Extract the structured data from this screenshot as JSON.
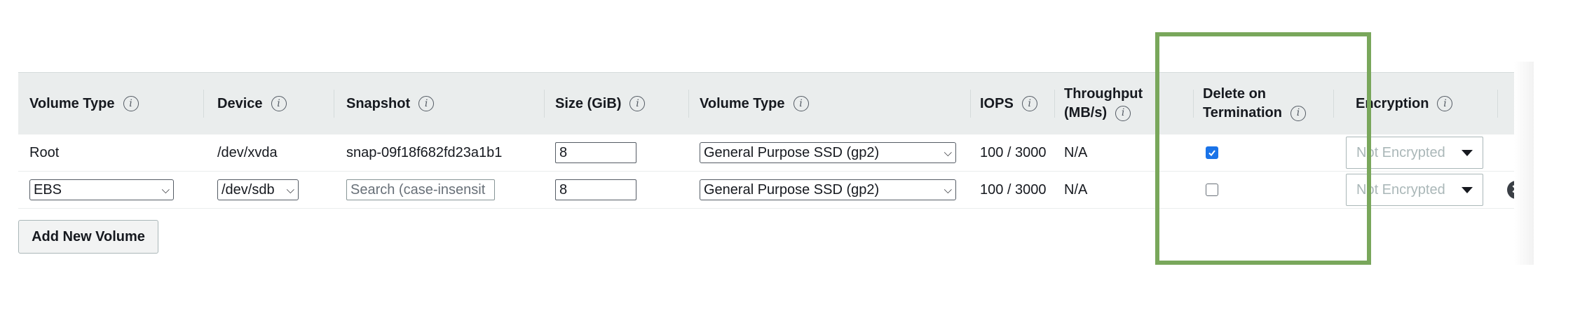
{
  "columns": [
    {
      "label": "Volume Type",
      "info": "i"
    },
    {
      "label": "Device",
      "info": "i"
    },
    {
      "label": "Snapshot",
      "info": "i"
    },
    {
      "label": "Size (GiB)",
      "info": "i"
    },
    {
      "label": "Volume Type",
      "info": "i"
    },
    {
      "label": "IOPS",
      "info": "i"
    },
    {
      "label_line1": "Throughput",
      "label_line2": "(MB/s)",
      "info": "i"
    },
    {
      "label_line1": "Delete on",
      "label_line2": "Termination",
      "info": "i"
    },
    {
      "label": "Encryption",
      "info": "i"
    }
  ],
  "rows": [
    {
      "volume_type": "Root",
      "device": "/dev/xvda",
      "snapshot": "snap-09f18f682fd23a1b1",
      "size": "8",
      "ebs_volume_type": "General Purpose SSD (gp2)",
      "iops": "100 / 3000",
      "throughput": "N/A",
      "delete_on_termination": true,
      "encryption": "Not Encrypted"
    },
    {
      "volume_type": "EBS",
      "device": "/dev/sdb",
      "snapshot_placeholder": "Search (case-insensit",
      "size": "8",
      "ebs_volume_type": "General Purpose SSD (gp2)",
      "iops": "100 / 3000",
      "throughput": "N/A",
      "delete_on_termination": false,
      "encryption": "Not Encrypted"
    }
  ],
  "add_button_label": "Add New Volume",
  "icons": {
    "info": "info-icon",
    "remove": "remove-circle-icon",
    "check": "checkmark-icon"
  },
  "colors": {
    "header_bg": "#eaeded",
    "checkbox_checked": "#1a73e8",
    "highlight_border": "#79a75b"
  }
}
